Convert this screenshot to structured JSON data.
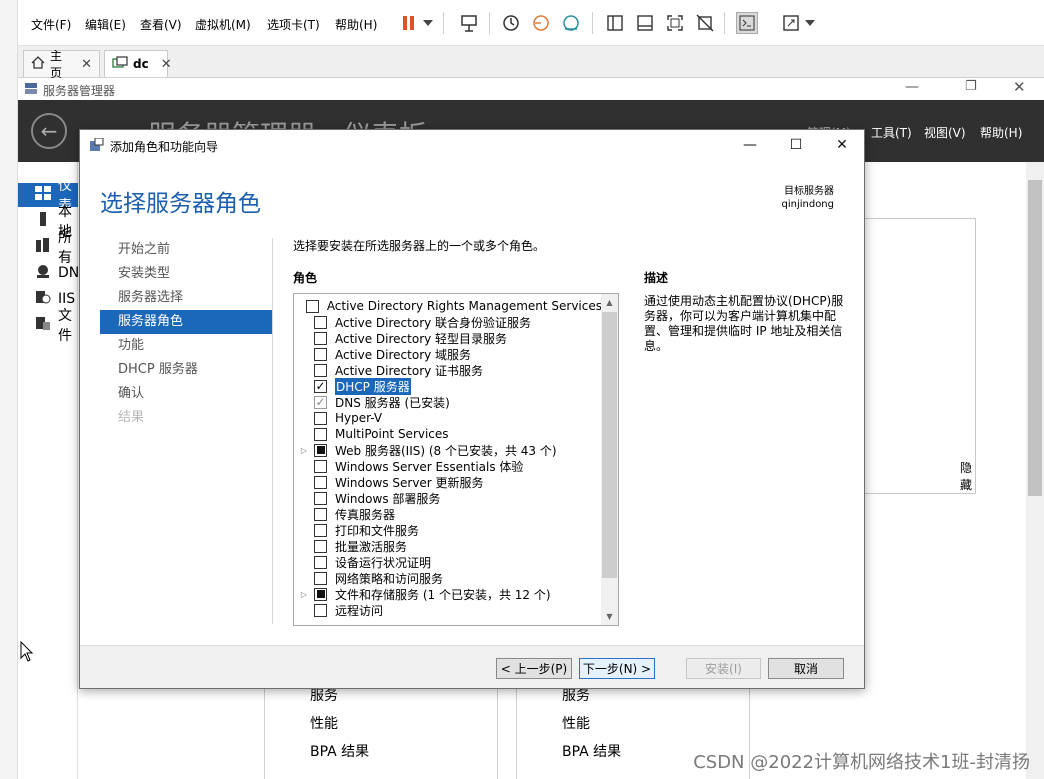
{
  "vmware": {
    "menu": [
      "文件(F)",
      "编辑(E)",
      "查看(V)",
      "虚拟机(M)",
      "选项卡(T)",
      "帮助(H)"
    ],
    "tabs": [
      {
        "label": "主页",
        "icon": "home-icon"
      },
      {
        "label": "dc",
        "icon": "vm-icon"
      }
    ]
  },
  "server_manager": {
    "window_title": "服务器管理器",
    "header_title": "服务器管理器 · 仪表板",
    "header_menu": [
      "管理(M)",
      "工具(T)",
      "视图(V)",
      "帮助(H)"
    ],
    "nav": [
      {
        "label": "仪表",
        "selected": true
      },
      {
        "label": "本地",
        "selected": false
      },
      {
        "label": "所有",
        "selected": false
      },
      {
        "label": "DN",
        "selected": false
      },
      {
        "label": "IIS",
        "selected": false
      },
      {
        "label": "文件",
        "selected": false
      }
    ],
    "hide_label": "隐藏",
    "tiles": [
      {
        "items": [
          "服务",
          "性能",
          "BPA 结果"
        ]
      },
      {
        "items": [
          "服务",
          "性能",
          "BPA 结果"
        ]
      }
    ]
  },
  "wizard": {
    "title": "添加角色和功能向导",
    "heading": "选择服务器角色",
    "target_label": "目标服务器",
    "target_server": "qinjindong",
    "steps": [
      {
        "label": "开始之前",
        "state": "normal"
      },
      {
        "label": "安装类型",
        "state": "normal"
      },
      {
        "label": "服务器选择",
        "state": "normal"
      },
      {
        "label": "服务器角色",
        "state": "active"
      },
      {
        "label": "功能",
        "state": "normal"
      },
      {
        "label": "DHCP 服务器",
        "state": "normal"
      },
      {
        "label": "确认",
        "state": "normal"
      },
      {
        "label": "结果",
        "state": "disabled"
      }
    ],
    "instruction": "选择要安装在所选服务器上的一个或多个角色。",
    "roles_header": "角色",
    "description_header": "描述",
    "description": "通过使用动态主机配置协议(DHCP)服务器，你可以为客户端计算机集中配置、管理和提供临时 IP 地址及相关信息。",
    "roles": [
      {
        "label": "Active Directory Rights Management Services",
        "state": "unchecked",
        "expandable": false
      },
      {
        "label": "Active Directory 联合身份验证服务",
        "state": "unchecked",
        "expandable": false
      },
      {
        "label": "Active Directory 轻型目录服务",
        "state": "unchecked",
        "expandable": false
      },
      {
        "label": "Active Directory 域服务",
        "state": "unchecked",
        "expandable": false
      },
      {
        "label": "Active Directory 证书服务",
        "state": "unchecked",
        "expandable": false
      },
      {
        "label": "DHCP 服务器",
        "state": "checked",
        "expandable": false,
        "selected": true
      },
      {
        "label": "DNS 服务器 (已安装)",
        "state": "installed",
        "expandable": false
      },
      {
        "label": "Hyper-V",
        "state": "unchecked",
        "expandable": false
      },
      {
        "label": "MultiPoint Services",
        "state": "unchecked",
        "expandable": false
      },
      {
        "label": "Web 服务器(IIS) (8 个已安装，共 43 个)",
        "state": "partial",
        "expandable": true
      },
      {
        "label": "Windows Server Essentials 体验",
        "state": "unchecked",
        "expandable": false
      },
      {
        "label": "Windows Server 更新服务",
        "state": "unchecked",
        "expandable": false
      },
      {
        "label": "Windows 部署服务",
        "state": "unchecked",
        "expandable": false
      },
      {
        "label": "传真服务器",
        "state": "unchecked",
        "expandable": false
      },
      {
        "label": "打印和文件服务",
        "state": "unchecked",
        "expandable": false
      },
      {
        "label": "批量激活服务",
        "state": "unchecked",
        "expandable": false
      },
      {
        "label": "设备运行状况证明",
        "state": "unchecked",
        "expandable": false
      },
      {
        "label": "网络策略和访问服务",
        "state": "unchecked",
        "expandable": false
      },
      {
        "label": "文件和存储服务 (1 个已安装，共 12 个)",
        "state": "partial",
        "expandable": true
      },
      {
        "label": "远程访问",
        "state": "unchecked",
        "expandable": false
      }
    ],
    "buttons": {
      "previous": "< 上一步(P)",
      "next": "下一步(N) >",
      "install": "安装(I)",
      "cancel": "取消"
    }
  },
  "watermark": "CSDN @2022计算机网络技术1班-封清扬",
  "colors": {
    "accent": "#1b67b9",
    "heading": "#1b5fae",
    "header_dark": "#303030",
    "vm_pause": "#e0502a"
  }
}
